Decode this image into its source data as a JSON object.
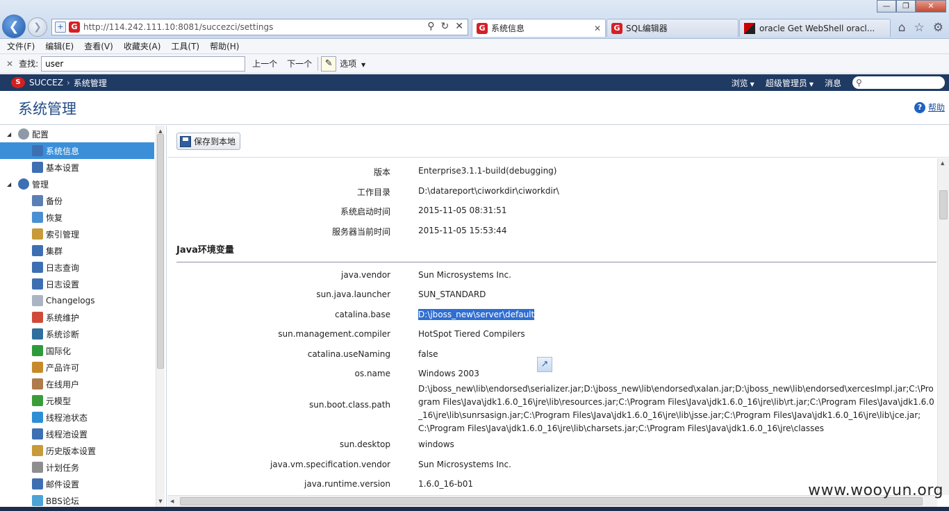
{
  "browser": {
    "address": "http://114.242.111.10:8081/succezci/settings",
    "address_host": "114.242.111.10",
    "tabs": [
      {
        "label": "系统信息",
        "active": true
      },
      {
        "label": "SQL编辑器",
        "active": false
      },
      {
        "label": "oracle Get WebShell oracl...",
        "active": false
      }
    ],
    "menu": [
      "文件(F)",
      "编辑(E)",
      "查看(V)",
      "收藏夹(A)",
      "工具(T)",
      "帮助(H)"
    ],
    "find": {
      "label": "查找:",
      "value": "user",
      "prev": "上一个",
      "next": "下一个",
      "options": "选项"
    }
  },
  "app": {
    "brand": "SUCCEZ",
    "crumb": "系统管理",
    "nav": {
      "browse": "浏览",
      "admin": "超级管理员",
      "messages": "消息"
    },
    "page_title": "系统管理",
    "help": "帮助",
    "accent": "#1f3a63",
    "selection": "#3b8fd9"
  },
  "sidebar": {
    "groups": [
      {
        "label": "配置",
        "items": [
          {
            "label": "系统信息",
            "icon": "monitor-icon",
            "selected": true
          },
          {
            "label": "基本设置",
            "icon": "settings-window-icon"
          }
        ]
      },
      {
        "label": "管理",
        "items": [
          {
            "label": "备份",
            "icon": "backup-icon"
          },
          {
            "label": "恢复",
            "icon": "restore-icon"
          },
          {
            "label": "索引管理",
            "icon": "book-icon"
          },
          {
            "label": "集群",
            "icon": "cluster-icon"
          },
          {
            "label": "日志查询",
            "icon": "log-search-icon"
          },
          {
            "label": "日志设置",
            "icon": "log-settings-icon"
          },
          {
            "label": "Changelogs",
            "icon": "document-icon"
          },
          {
            "label": "系统维护",
            "icon": "tools-icon"
          },
          {
            "label": "系统诊断",
            "icon": "diagnose-icon"
          },
          {
            "label": "国际化",
            "icon": "globe-icon"
          },
          {
            "label": "产品许可",
            "icon": "license-icon"
          },
          {
            "label": "在线用户",
            "icon": "user-icon"
          },
          {
            "label": "元模型",
            "icon": "model-icon"
          },
          {
            "label": "线程池状态",
            "icon": "thread-pool-icon"
          },
          {
            "label": "线程池设置",
            "icon": "thread-settings-icon"
          },
          {
            "label": "历史版本设置",
            "icon": "history-icon"
          },
          {
            "label": "计划任务",
            "icon": "schedule-icon"
          },
          {
            "label": "邮件设置",
            "icon": "mail-icon"
          },
          {
            "label": "BBS论坛",
            "icon": "forum-icon"
          }
        ]
      }
    ]
  },
  "main": {
    "save_button": "保存到本地",
    "basic": [
      {
        "key": "版本",
        "value": "Enterprise3.1.1-build(debugging)"
      },
      {
        "key": "工作目录",
        "value": "D:\\datareport\\ciworkdir\\ciworkdir\\"
      },
      {
        "key": "系统启动时间",
        "value": "2015-11-05 08:31:51"
      },
      {
        "key": "服务器当前时间",
        "value": "2015-11-05 15:53:44"
      }
    ],
    "java_section_title": "Java环境变量",
    "java": [
      {
        "key": "java.vendor",
        "value": "Sun Microsystems Inc."
      },
      {
        "key": "sun.java.launcher",
        "value": "SUN_STANDARD"
      },
      {
        "key": "catalina.base",
        "value": "D:\\jboss_new\\server\\default"
      },
      {
        "key": "sun.management.compiler",
        "value": "HotSpot Tiered Compilers"
      },
      {
        "key": "catalina.useNaming",
        "value": "false"
      },
      {
        "key": "os.name",
        "value": "Windows 2003"
      },
      {
        "key": "sun.boot.class.path",
        "value": "D:\\jboss_new\\lib\\endorsed\\serializer.jar;D:\\jboss_new\\lib\\endorsed\\xalan.jar;D:\\jboss_new\\lib\\endorsed\\xercesImpl.jar;C:\\Program Files\\Java\\jdk1.6.0_16\\jre\\lib\\resources.jar;C:\\Program Files\\Java\\jdk1.6.0_16\\jre\\lib\\rt.jar;C:\\Program Files\\Java\\jdk1.6.0_16\\jre\\lib\\sunrsasign.jar;C:\\Program Files\\Java\\jdk1.6.0_16\\jre\\lib\\jsse.jar;C:\\Program Files\\Java\\jdk1.6.0_16\\jre\\lib\\jce.jar;C:\\Program Files\\Java\\jdk1.6.0_16\\jre\\lib\\charsets.jar;C:\\Program Files\\Java\\jdk1.6.0_16\\jre\\classes"
      },
      {
        "key": "sun.desktop",
        "value": "windows"
      },
      {
        "key": "java.vm.specification.vendor",
        "value": "Sun Microsystems Inc."
      },
      {
        "key": "java.runtime.version",
        "value": "1.6.0_16-b01"
      }
    ]
  },
  "watermark": "www.wooyun.org"
}
